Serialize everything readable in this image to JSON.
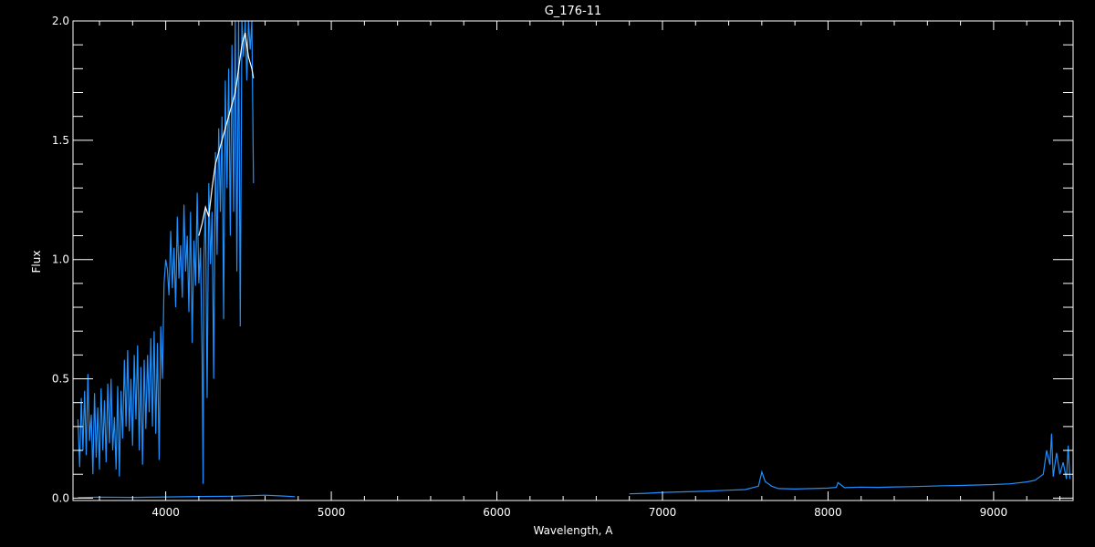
{
  "chart_data": {
    "type": "line",
    "title": "G_176-11",
    "xlabel": "Wavelength, A",
    "ylabel": "Flux",
    "xlim": [
      3440,
      9480
    ],
    "ylim": [
      -0.01,
      2.0
    ],
    "x_ticks": [
      4000,
      5000,
      6000,
      7000,
      8000,
      9000
    ],
    "x_tick_labels": [
      "4000",
      "5000",
      "6000",
      "7000",
      "8000",
      "9000"
    ],
    "y_ticks": [
      0.0,
      0.5,
      1.0,
      1.5,
      2.0
    ],
    "y_tick_labels": [
      "0.0",
      "0.5",
      "1.0",
      "1.5",
      "2.0"
    ],
    "grid": false,
    "colors": {
      "background": "#000000",
      "axes": "#ffffff",
      "blue": "#1e90ff",
      "white": "#ffffff"
    },
    "series": [
      {
        "color": "#1e90ff",
        "x": [
          3470,
          3480,
          3490,
          3500,
          3510,
          3520,
          3530,
          3540,
          3550,
          3560,
          3570,
          3580,
          3590,
          3600,
          3610,
          3620,
          3630,
          3640,
          3650,
          3660,
          3670,
          3680,
          3690,
          3700,
          3710,
          3720,
          3730,
          3740,
          3750,
          3760,
          3770,
          3780,
          3790,
          3800,
          3810,
          3820,
          3830,
          3840,
          3850,
          3860,
          3870,
          3880,
          3890,
          3900,
          3910,
          3920,
          3930,
          3940,
          3950,
          3960,
          3970,
          3980,
          3990,
          4000,
          4010,
          4020,
          4030,
          4040,
          4050,
          4060,
          4070,
          4080,
          4090,
          4100,
          4110,
          4120,
          4130,
          4140,
          4150,
          4160,
          4170,
          4180,
          4190,
          4200,
          4210,
          4220,
          4226,
          4230,
          4240,
          4250,
          4260,
          4270,
          4280,
          4290,
          4300,
          4310,
          4320,
          4330,
          4340,
          4350,
          4360,
          4370,
          4380,
          4390,
          4400,
          4410,
          4420,
          4430,
          4440,
          4450,
          4460,
          4470,
          4480,
          4490,
          4500,
          4510,
          4520,
          4530
        ],
        "y": [
          0.33,
          0.13,
          0.42,
          0.2,
          0.45,
          0.18,
          0.52,
          0.24,
          0.35,
          0.1,
          0.44,
          0.17,
          0.38,
          0.12,
          0.46,
          0.2,
          0.41,
          0.15,
          0.48,
          0.23,
          0.5,
          0.2,
          0.34,
          0.12,
          0.47,
          0.09,
          0.45,
          0.25,
          0.58,
          0.3,
          0.62,
          0.28,
          0.5,
          0.22,
          0.6,
          0.33,
          0.64,
          0.2,
          0.55,
          0.14,
          0.58,
          0.29,
          0.6,
          0.36,
          0.67,
          0.3,
          0.7,
          0.27,
          0.65,
          0.16,
          0.72,
          0.5,
          0.9,
          1.0,
          0.96,
          0.85,
          1.12,
          0.88,
          1.05,
          0.8,
          1.18,
          0.92,
          1.06,
          0.84,
          1.23,
          0.95,
          1.1,
          0.78,
          1.2,
          0.65,
          1.08,
          0.89,
          1.28,
          0.9,
          1.05,
          0.6,
          0.06,
          1.0,
          1.22,
          0.42,
          1.32,
          0.98,
          1.2,
          0.5,
          1.45,
          1.02,
          1.55,
          1.2,
          1.6,
          0.75,
          1.75,
          1.3,
          1.8,
          1.1,
          1.9,
          1.2,
          2.0,
          0.95,
          2.0,
          0.72,
          2.0,
          1.85,
          2.0,
          1.75,
          2.0,
          1.88,
          2.0,
          1.32
        ]
      },
      {
        "color": "#1e90ff",
        "x": [
          3470,
          3600,
          3800,
          4000,
          4200,
          4400,
          4600,
          4700,
          4780
        ],
        "y": [
          0.002,
          0.004,
          0.003,
          0.005,
          0.007,
          0.008,
          0.012,
          0.009,
          0.006
        ]
      },
      {
        "color": "#ffffff",
        "x": [
          4200,
          4220,
          4240,
          4260,
          4280,
          4300,
          4320,
          4340,
          4360,
          4380,
          4400,
          4420,
          4440,
          4460,
          4480,
          4500,
          4520,
          4530
        ],
        "y": [
          1.1,
          1.15,
          1.22,
          1.18,
          1.3,
          1.4,
          1.45,
          1.5,
          1.55,
          1.6,
          1.65,
          1.7,
          1.8,
          1.9,
          1.95,
          1.85,
          1.8,
          1.76
        ]
      },
      {
        "color": "#1e90ff",
        "x": [
          6800,
          6900,
          7000,
          7100,
          7200,
          7300,
          7400,
          7500,
          7580,
          7600,
          7620,
          7660,
          7700,
          7800,
          7900,
          8000,
          8050,
          8060,
          8100,
          8200,
          8300,
          8400,
          8500,
          8600,
          8700,
          8800,
          8900,
          9000,
          9100,
          9200,
          9250,
          9300,
          9320,
          9340,
          9350,
          9360,
          9380,
          9400,
          9420,
          9440,
          9450,
          9460
        ],
        "y": [
          0.018,
          0.02,
          0.024,
          0.026,
          0.028,
          0.03,
          0.033,
          0.036,
          0.05,
          0.11,
          0.07,
          0.05,
          0.04,
          0.038,
          0.04,
          0.042,
          0.045,
          0.065,
          0.044,
          0.046,
          0.045,
          0.047,
          0.048,
          0.05,
          0.052,
          0.053,
          0.055,
          0.057,
          0.06,
          0.068,
          0.075,
          0.1,
          0.2,
          0.14,
          0.27,
          0.09,
          0.19,
          0.1,
          0.15,
          0.08,
          0.22,
          0.08
        ]
      }
    ]
  }
}
